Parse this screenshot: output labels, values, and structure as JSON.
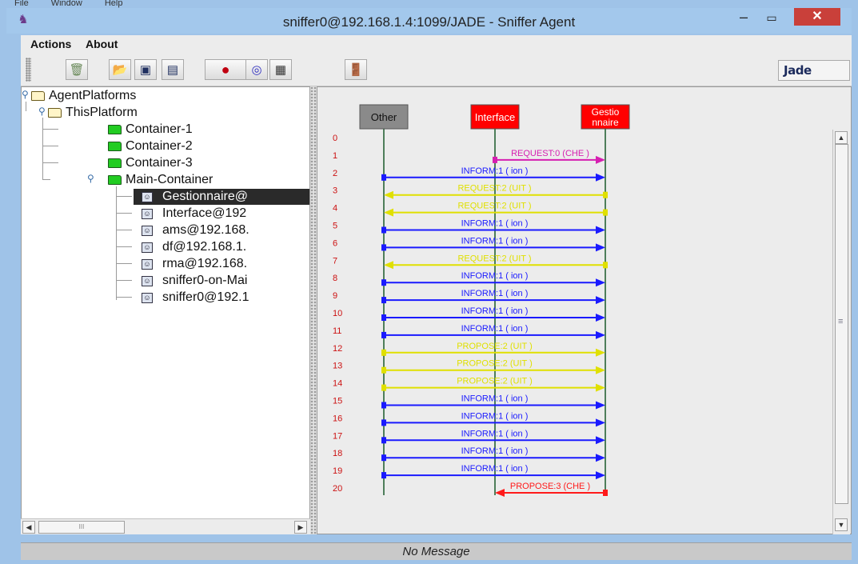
{
  "menu_remnant": [
    "File",
    "Window",
    "Help"
  ],
  "titlebar": {
    "title": "sniffer0@192.168.1.4:1099/JADE - Sniffer Agent",
    "minimize": "–",
    "maximize": "▭",
    "close": "✕"
  },
  "menu": {
    "items": [
      "Actions",
      "About"
    ]
  },
  "toolbar": {
    "buttons": [
      {
        "icon": "trash-icon"
      },
      {
        "icon": "open-folder-icon"
      },
      {
        "icon": "save-icon"
      },
      {
        "icon": "save-as-icon"
      },
      {
        "icon": "record-icon"
      },
      {
        "icon": "show-agent-icon"
      },
      {
        "icon": "filter-icon"
      },
      {
        "icon": "exit-door-icon"
      }
    ],
    "logo_text": "Jade"
  },
  "tree": {
    "root": "AgentPlatforms",
    "platform": "ThisPlatform",
    "containers": [
      "Container-1",
      "Container-2",
      "Container-3"
    ],
    "main_container": "Main-Container",
    "agents": [
      {
        "label": "Gestionnaire@",
        "selected": true
      },
      {
        "label": "Interface@192",
        "selected": false
      },
      {
        "label": "ams@192.168.",
        "selected": false
      },
      {
        "label": "df@192.168.1.",
        "selected": false
      },
      {
        "label": "rma@192.168.",
        "selected": false
      },
      {
        "label": "sniffer0-on-Mai",
        "selected": false
      },
      {
        "label": "sniffer0@192.1",
        "selected": false
      }
    ]
  },
  "diagram": {
    "lifelines": [
      {
        "name": "Other",
        "color": "#8a8a8a",
        "text_color": "#111111"
      },
      {
        "name": "Interface",
        "color": "#ff0000",
        "text_color": "#ffffff"
      },
      {
        "name": "Gestio nnaire",
        "color": "#ff0000",
        "text_color": "#ffffff"
      }
    ],
    "row_numbers": [
      "0",
      "1",
      "2",
      "3",
      "4",
      "5",
      "6",
      "7",
      "8",
      "9",
      "10",
      "11",
      "12",
      "13",
      "14",
      "15",
      "16",
      "17",
      "18",
      "19",
      "20"
    ],
    "messages": [
      {
        "row": 1,
        "label": "REQUEST:0 (CHE        )",
        "from": 1,
        "to": 2,
        "color": "#d61fb1"
      },
      {
        "row": 2,
        "label": "INFORM:1 (     ion )",
        "from": 0,
        "to": 2,
        "color": "#1a1aff"
      },
      {
        "row": 3,
        "label": "REQUEST:2 (UIT        )",
        "from": 2,
        "to": 0,
        "color": "#e0e000"
      },
      {
        "row": 4,
        "label": "REQUEST:2 (UIT        )",
        "from": 2,
        "to": 0,
        "color": "#e0e000"
      },
      {
        "row": 5,
        "label": "INFORM:1 (     ion )",
        "from": 0,
        "to": 2,
        "color": "#1a1aff"
      },
      {
        "row": 6,
        "label": "INFORM:1 (     ion )",
        "from": 0,
        "to": 2,
        "color": "#1a1aff"
      },
      {
        "row": 7,
        "label": "REQUEST:2 (UIT        )",
        "from": 2,
        "to": 0,
        "color": "#e0e000"
      },
      {
        "row": 8,
        "label": "INFORM:1 (     ion )",
        "from": 0,
        "to": 2,
        "color": "#1a1aff"
      },
      {
        "row": 9,
        "label": "INFORM:1 (     ion )",
        "from": 0,
        "to": 2,
        "color": "#1a1aff"
      },
      {
        "row": 10,
        "label": "INFORM:1 (     ion )",
        "from": 0,
        "to": 2,
        "color": "#1a1aff"
      },
      {
        "row": 11,
        "label": "INFORM:1 (     ion )",
        "from": 0,
        "to": 2,
        "color": "#1a1aff"
      },
      {
        "row": 12,
        "label": "PROPOSE:2 (UIT        )",
        "from": 0,
        "to": 2,
        "color": "#e0e000"
      },
      {
        "row": 13,
        "label": "PROPOSE:2 (UIT        )",
        "from": 0,
        "to": 2,
        "color": "#e0e000"
      },
      {
        "row": 14,
        "label": "PROPOSE:2 (UIT        )",
        "from": 0,
        "to": 2,
        "color": "#e0e000"
      },
      {
        "row": 15,
        "label": "INFORM:1 (     ion )",
        "from": 0,
        "to": 2,
        "color": "#1a1aff"
      },
      {
        "row": 16,
        "label": "INFORM:1 (     ion )",
        "from": 0,
        "to": 2,
        "color": "#1a1aff"
      },
      {
        "row": 17,
        "label": "INFORM:1 (     ion )",
        "from": 0,
        "to": 2,
        "color": "#1a1aff"
      },
      {
        "row": 18,
        "label": "INFORM:1 (     ion )",
        "from": 0,
        "to": 2,
        "color": "#1a1aff"
      },
      {
        "row": 19,
        "label": "INFORM:1 (     ion )",
        "from": 0,
        "to": 2,
        "color": "#1a1aff"
      },
      {
        "row": 20,
        "label": "PROPOSE:3 (CHE        )",
        "from": 2,
        "to": 1,
        "color": "#ff1a1a"
      }
    ]
  },
  "tree_scroll": {
    "left": "◀",
    "right": "▶",
    "thumb": "III"
  },
  "vscroll": {
    "up": "▲",
    "down": "▼",
    "grip": "≡"
  },
  "status": "No Message"
}
